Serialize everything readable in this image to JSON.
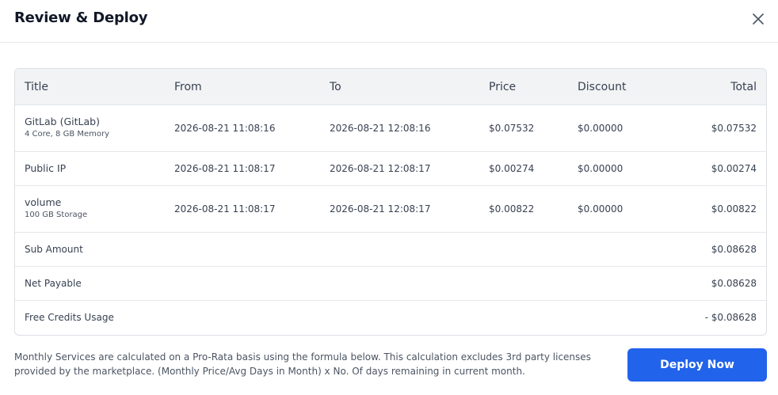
{
  "dialog": {
    "title": "Review & Deploy",
    "close_icon": "close-icon"
  },
  "table": {
    "columns": [
      "Title",
      "From",
      "To",
      "Price",
      "Discount",
      "Total"
    ],
    "items": [
      {
        "name": "GitLab (GitLab)",
        "detail": "4 Core, 8 GB Memory",
        "from": "2026-08-21 11:08:16",
        "to": "2026-08-21 12:08:16",
        "price": "$0.07532",
        "discount": "$0.00000",
        "total": "$0.07532"
      },
      {
        "name": "Public IP",
        "detail": "",
        "from": "2026-08-21 11:08:17",
        "to": "2026-08-21 12:08:17",
        "price": "$0.00274",
        "discount": "$0.00000",
        "total": "$0.00274"
      },
      {
        "name": "volume",
        "detail": "100 GB Storage",
        "from": "2026-08-21 11:08:17",
        "to": "2026-08-21 12:08:17",
        "price": "$0.00822",
        "discount": "$0.00000",
        "total": "$0.00822"
      }
    ],
    "summary": [
      {
        "label": "Sub Amount",
        "value": "$0.08628"
      },
      {
        "label": "Net Payable",
        "value": "$0.08628"
      },
      {
        "label": "Free Credits Usage",
        "value": "- $0.08628"
      }
    ]
  },
  "footer": {
    "note": "Monthly Services are calculated on a Pro-Rata basis using the formula below. This calculation excludes 3rd party licenses provided by the marketplace. (Monthly Price/Avg Days in Month) x No. Of days remaining in current month.",
    "deploy_label": "Deploy Now"
  },
  "colors": {
    "accent": "#2163ea",
    "header_bg": "#f2f3f5",
    "border": "#dcdfe4"
  }
}
